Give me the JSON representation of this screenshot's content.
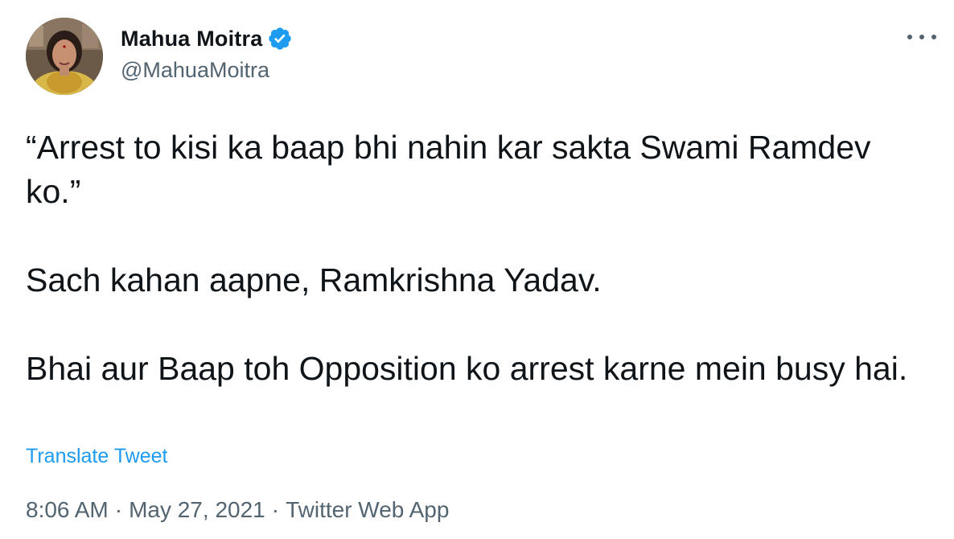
{
  "author": {
    "display_name": "Mahua Moitra",
    "handle": "@MahuaMoitra",
    "verified": true,
    "avatar_icon": "profile-photo",
    "verified_icon": "verified-badge-icon"
  },
  "tweet": {
    "paragraphs": [
      "“Arrest to kisi ka baap bhi nahin kar sakta Swami Ramdev ko.”",
      "Sach kahan aapne, Ramkrishna Yadav.",
      "Bhai aur Baap toh Opposition ko arrest karne mein busy hai."
    ],
    "translate_label": "Translate Tweet",
    "time": "8:06 AM",
    "date": "May 27, 2021",
    "source": "Twitter Web App",
    "separator": "·"
  },
  "menu": {
    "icon": "more-options-icon"
  },
  "colors": {
    "text": "#0f1419",
    "secondary": "#536471",
    "link": "#1d9bf0",
    "verified": "#1d9bf0"
  }
}
